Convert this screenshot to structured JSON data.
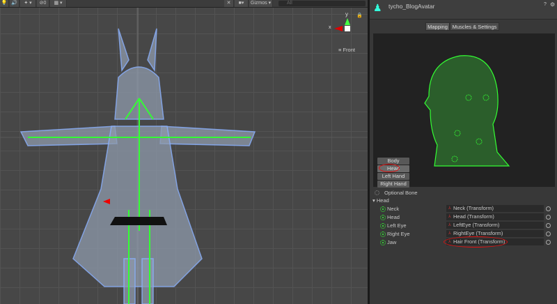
{
  "toolbar": {
    "gizmo_count": "0",
    "gizmos_label": "Gizmos",
    "search_placeholder": "All"
  },
  "scene": {
    "axis_x": "x",
    "axis_y": "y",
    "view_label": "Front"
  },
  "inspector": {
    "title": "tycho_BlogAvatar",
    "tabs": [
      {
        "label": "Mapping",
        "active": true
      },
      {
        "label": "Muscles & Settings",
        "active": false
      }
    ],
    "body_parts": [
      "Body",
      "Head",
      "Left Hand",
      "Right Hand"
    ],
    "optional_bone_label": "Optional Bone",
    "section": "Head",
    "bones": [
      {
        "name": "Neck",
        "value": "Neck (Transform)"
      },
      {
        "name": "Head",
        "value": "Head (Transform)"
      },
      {
        "name": "Left Eye",
        "value": "LeftEye (Transform)"
      },
      {
        "name": "Right Eye",
        "value": "RightEye (Transform)"
      },
      {
        "name": "Jaw",
        "value": "Hair Front (Transform)"
      }
    ]
  },
  "colors": {
    "bone_green": "#33ff33",
    "annotation_red": "#e01010"
  }
}
